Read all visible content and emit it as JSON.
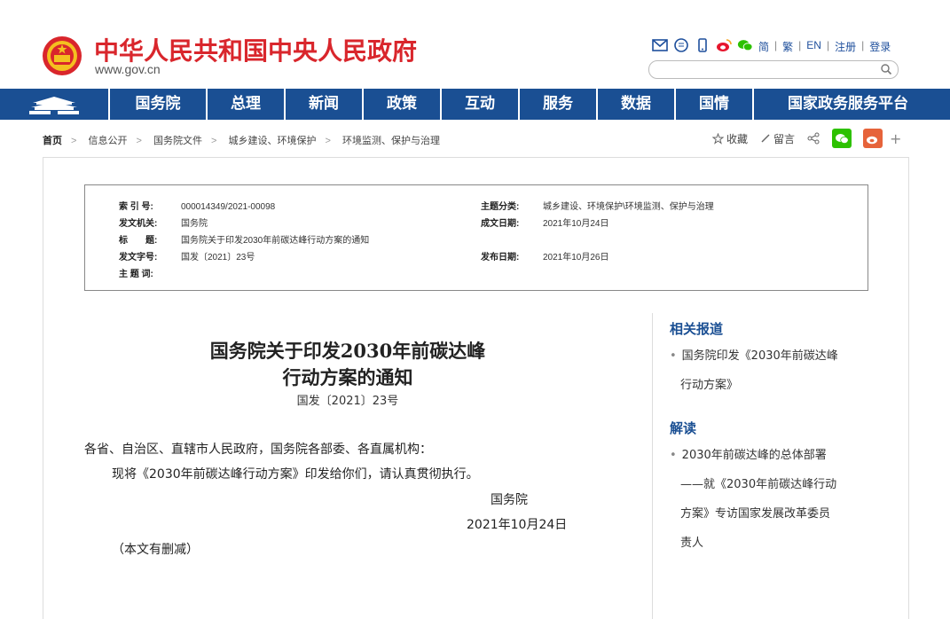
{
  "header": {
    "site_name": "中华人民共和国中央人民政府",
    "site_url": "www.gov.cn",
    "links": [
      "简",
      "繁",
      "EN",
      "注册",
      "登录"
    ],
    "search_placeholder": ""
  },
  "nav": {
    "items": [
      "国务院",
      "总理",
      "新闻",
      "政策",
      "互动",
      "服务",
      "数据",
      "国情",
      "国家政务服务平台"
    ]
  },
  "breadcrumb": [
    "首页",
    "信息公开",
    "国务院文件",
    "城乡建设、环境保护",
    "环境监测、保护与治理"
  ],
  "tools": {
    "favorite": "收藏",
    "comment": "留言",
    "more": "+"
  },
  "meta": {
    "index_label": "索 引 号:",
    "index_value": "000014349/2021-00098",
    "category_label": "主题分类:",
    "category_value": "城乡建设、环境保护\\环境监测、保护与治理",
    "issuer_label": "发文机关:",
    "issuer_value": "国务院",
    "created_label": "成文日期:",
    "created_value": "2021年10月24日",
    "title_label": "标　　题:",
    "title_value": "国务院关于印发2030年前碳达峰行动方案的通知",
    "docno_label": "发文字号:",
    "docno_value": "国发〔2021〕23号",
    "published_label": "发布日期:",
    "published_value": "2021年10月26日",
    "keywords_label": "主 题 词:",
    "keywords_value": ""
  },
  "article": {
    "title_line1": "国务院关于印发2030年前碳达峰",
    "title_line2": "行动方案的通知",
    "doc_number": "国发〔2021〕23号",
    "salutation": "各省、自治区、直辖市人民政府，国务院各部委、各直属机构：",
    "body": "现将《2030年前碳达峰行动方案》印发给你们，请认真贯彻执行。",
    "signature": "国务院",
    "date": "2021年10月24日",
    "note": "（本文有删减）"
  },
  "sidebar": {
    "related_heading": "相关报道",
    "related_line1": "国务院印发《2030年前碳达峰",
    "related_line2": "行动方案》",
    "interp_heading": "解读",
    "interp_line1": "2030年前碳达峰的总体部署",
    "interp_line2": "——就《2030年前碳达峰行动",
    "interp_line3": "方案》专访国家发展改革委员",
    "interp_line4": "责人"
  },
  "colors": {
    "brand_red": "#d9262c",
    "nav_blue": "#1a4f93",
    "wechat_green": "#2dc100",
    "weibo_orange": "#e6633a"
  }
}
